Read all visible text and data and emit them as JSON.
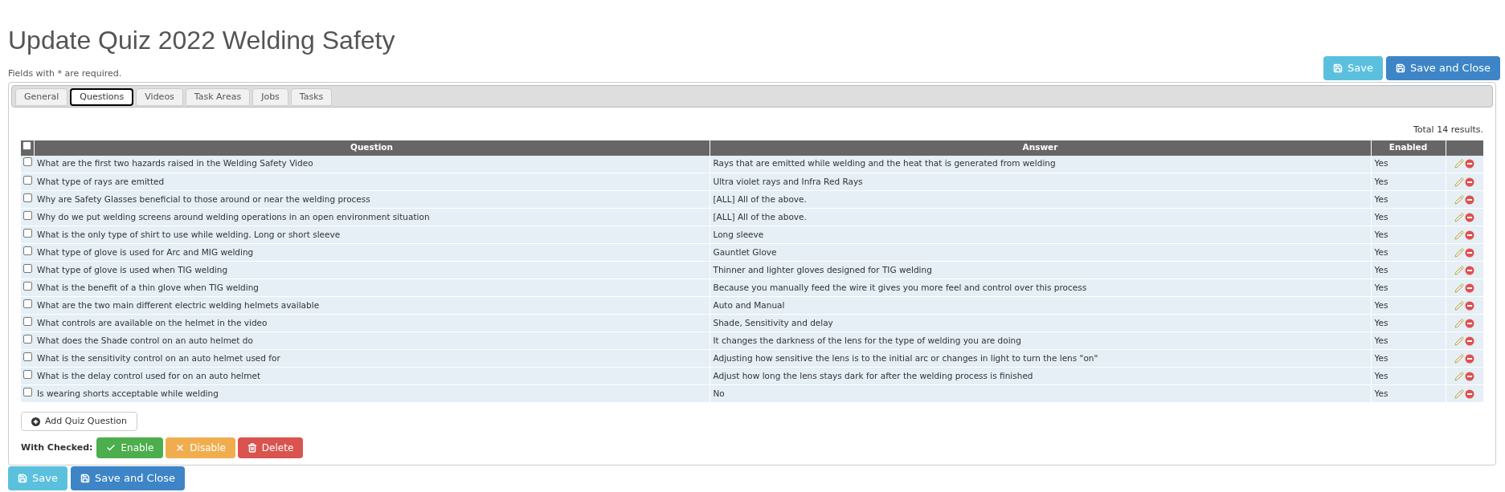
{
  "page": {
    "title": "Update Quiz 2022 Welding Safety",
    "note": "Fields with * are required."
  },
  "top_buttons": [
    {
      "label": "Save",
      "kind": "save"
    },
    {
      "label": "Save and Close",
      "kind": "save_close"
    }
  ],
  "tabs": [
    {
      "label": "General",
      "selected": false
    },
    {
      "label": "Questions",
      "selected": true
    },
    {
      "label": "Videos",
      "selected": false
    },
    {
      "label": "Task Areas",
      "selected": false
    },
    {
      "label": "Jobs",
      "selected": false
    },
    {
      "label": "Tasks",
      "selected": false
    }
  ],
  "total": "Total 14 results.",
  "table": {
    "select_all_checked": false,
    "columns": [
      "Question",
      "Answer",
      "Enabled"
    ],
    "rows": [
      {
        "checked": false,
        "question": "What are the first two hazards raised in the Welding Safety Video",
        "answer": "Rays that are emitted while welding and the heat that is generated from welding",
        "enabled": "Yes"
      },
      {
        "checked": false,
        "question": "What type of rays are emitted",
        "answer": "Ultra violet rays and Infra Red Rays",
        "enabled": "Yes"
      },
      {
        "checked": false,
        "question": "Why are Safety Glasses beneficial to those around or near the welding process",
        "answer": "[ALL] All of the above.",
        "enabled": "Yes"
      },
      {
        "checked": false,
        "question": "Why do we put welding screens around welding operations in an open environment situation",
        "answer": "[ALL] All of the above.",
        "enabled": "Yes"
      },
      {
        "checked": false,
        "question": "What is the only type of shirt to use while welding. Long or short sleeve",
        "answer": "Long sleeve",
        "enabled": "Yes"
      },
      {
        "checked": false,
        "question": "What type of glove is used for Arc and MIG welding",
        "answer": "Gauntlet Glove",
        "enabled": "Yes"
      },
      {
        "checked": false,
        "question": "What type of glove is used when TIG welding",
        "answer": "Thinner and lighter gloves designed for TIG welding",
        "enabled": "Yes"
      },
      {
        "checked": false,
        "question": "What is the benefit of a thin glove when TIG welding",
        "answer": "Because you manually feed the wire it gives you more feel and control over this process",
        "enabled": "Yes"
      },
      {
        "checked": false,
        "question": "What are the two main different electric welding helmets available",
        "answer": "Auto and Manual",
        "enabled": "Yes"
      },
      {
        "checked": false,
        "question": "What controls are available on the helmet in the video",
        "answer": "Shade, Sensitivity and delay",
        "enabled": "Yes"
      },
      {
        "checked": false,
        "question": "What does the Shade control on an auto helmet do",
        "answer": "It changes the darkness of the lens for the type of welding you are doing",
        "enabled": "Yes"
      },
      {
        "checked": false,
        "question": "What is the sensitivity control on an auto helmet used for",
        "answer": "Adjusting how sensitive the lens is to the initial arc or changes in light to turn the lens \"on\"",
        "enabled": "Yes"
      },
      {
        "checked": false,
        "question": "What is the delay control used for on an auto helmet",
        "answer": "Adjust how long the lens stays dark for after the welding process is finished",
        "enabled": "Yes"
      },
      {
        "checked": false,
        "question": "Is wearing shorts acceptable while welding",
        "answer": "No",
        "enabled": "Yes"
      }
    ]
  },
  "add_button": "Add Quiz Question",
  "with_checked": {
    "label": "With Checked:",
    "buttons": [
      {
        "label": "Enable",
        "kind": "enable"
      },
      {
        "label": "Disable",
        "kind": "disable"
      },
      {
        "label": "Delete",
        "kind": "delete"
      }
    ]
  },
  "bottom_buttons": [
    {
      "label": "Save",
      "kind": "save"
    },
    {
      "label": "Save and Close",
      "kind": "save_close"
    }
  ]
}
